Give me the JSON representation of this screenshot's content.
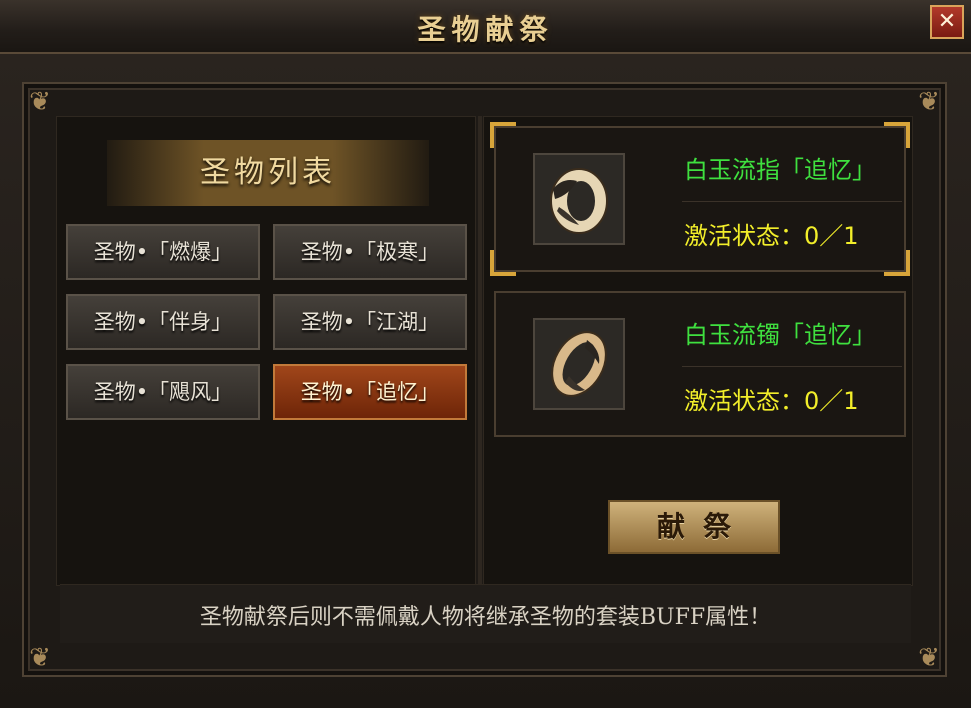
{
  "window": {
    "title": "圣物献祭",
    "close_label": "✕"
  },
  "list": {
    "header": "圣物列表",
    "items": [
      {
        "label": "圣物•「燃爆」",
        "selected": false
      },
      {
        "label": "圣物•「极寒」",
        "selected": false
      },
      {
        "label": "圣物•「伴身」",
        "selected": false
      },
      {
        "label": "圣物•「江湖」",
        "selected": false
      },
      {
        "label": "圣物•「飓风」",
        "selected": false
      },
      {
        "label": "圣物•「追忆」",
        "selected": true
      }
    ]
  },
  "items": [
    {
      "name": "白玉流指「追忆」",
      "status": "激活状态：0／1",
      "icon": "jade-ring-icon"
    },
    {
      "name": "白玉流镯「追忆」",
      "status": "激活状态：0／1",
      "icon": "jade-bracelet-icon"
    }
  ],
  "offer_button": "献祭",
  "tip": "圣物献祭后则不需佩戴人物将继承圣物的套装BUFF属性！",
  "colors": {
    "item_name": "#3fe03f",
    "item_status": "#f2ee2a",
    "selected_button": "#a0461a",
    "title_gold": "#e9cf93"
  }
}
